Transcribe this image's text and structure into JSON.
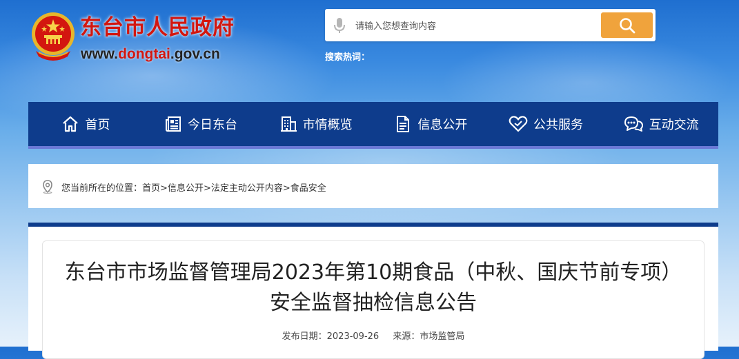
{
  "header": {
    "site_title": "东台市人民政府",
    "site_url_prefix": "www.",
    "site_url_domain": "dongtai",
    "site_url_suffix": ".gov.cn",
    "logo_icon": "national-emblem-icon"
  },
  "search": {
    "placeholder": "请输入您想查询内容",
    "hot_label": "搜索热词："
  },
  "nav": {
    "items": [
      {
        "label": "首页",
        "icon": "home-icon"
      },
      {
        "label": "今日东台",
        "icon": "news-icon"
      },
      {
        "label": "市情概览",
        "icon": "building-icon"
      },
      {
        "label": "信息公开",
        "icon": "document-icon"
      },
      {
        "label": "公共服务",
        "icon": "heart-icon"
      },
      {
        "label": "互动交流",
        "icon": "chat-icon"
      }
    ]
  },
  "breadcrumb": {
    "prefix": "您当前所在的位置：",
    "items": [
      "首页",
      "信息公开",
      "法定主动公开内容",
      "食品安全"
    ],
    "separator": ">"
  },
  "article": {
    "title": "东台市市场监督管理局2023年第10期食品（中秋、国庆节前专项）安全监督抽检信息公告",
    "date_label": "发布日期：2023-09-26",
    "source_label": "来源：市场监管局"
  },
  "colors": {
    "brand_red": "#d3160f",
    "nav_blue": "#0e3c8c",
    "search_orange": "#f0a33c",
    "nav_underline": "#6b79d6"
  }
}
